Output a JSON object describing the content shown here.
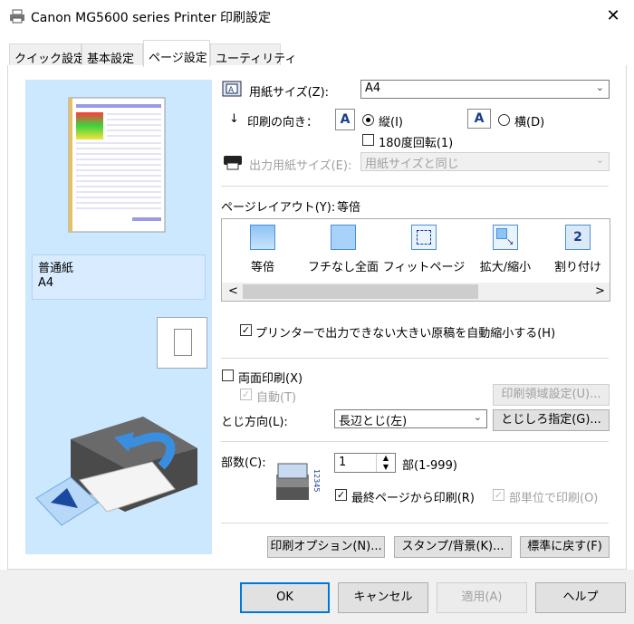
{
  "window": {
    "title": "Canon MG5600 series Printer 印刷設定"
  },
  "tabs": [
    {
      "label": "クイック設定"
    },
    {
      "label": "基本設定"
    },
    {
      "label": "ページ設定"
    },
    {
      "label": "ユーティリティ"
    }
  ],
  "preview": {
    "media_type": "普通紙",
    "paper_size": "A4"
  },
  "page_size": {
    "label": "用紙サイズ(Z):",
    "value": "A4"
  },
  "orientation": {
    "label": "印刷の向き：",
    "portrait": "縦(I)",
    "landscape": "横(D)",
    "rotate180": "180度回転(1)",
    "selected": "portrait"
  },
  "output_size": {
    "label": "出力用紙サイズ(E):",
    "value": "用紙サイズと同じ"
  },
  "page_layout": {
    "label": "ページレイアウト(Y):",
    "current": "等倍",
    "options": [
      "等倍",
      "フチなし全面",
      "フィットページ",
      "拡大/縮小",
      "割り付け"
    ],
    "scroll_left": "<",
    "scroll_right": ">"
  },
  "auto_reduce": {
    "label": "プリンターで出力できない大きい原稿を自動縮小する(H)",
    "checked": true
  },
  "duplex": {
    "label": "両面印刷(X)",
    "auto_label": "自動(T)",
    "area_button": "印刷領域設定(U)...",
    "stapling_label": "とじ方向(L):",
    "stapling_value": "長辺とじ(左)",
    "margin_button": "とじしろ指定(G)..."
  },
  "copies": {
    "label": "部数(C):",
    "value": "1",
    "range": "部(1-999)",
    "reverse_label": "最終ページから印刷(R)",
    "collate_label": "部単位で印刷(O)"
  },
  "buttons": {
    "print_options": "印刷オプション(N)...",
    "stamp": "スタンプ/背景(K)...",
    "defaults": "標準に戻す(F)",
    "ok": "OK",
    "cancel": "キャンセル",
    "apply": "適用(A)",
    "help": "ヘルプ"
  },
  "icons": {
    "app": "printer-icon",
    "close": "close-icon",
    "combo_arrow": "chevron-down-icon"
  }
}
